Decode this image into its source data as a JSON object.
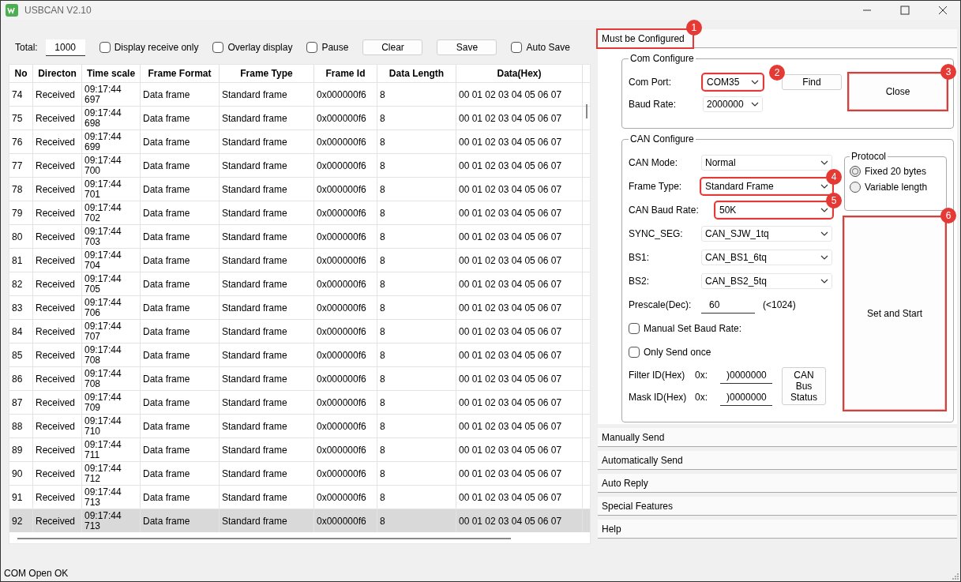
{
  "window": {
    "title": "USBCAN V2.10"
  },
  "toolbar": {
    "total_label": "Total:",
    "total_value": "1000",
    "options": [
      {
        "label": "Display receive only",
        "checked": false
      },
      {
        "label": "Overlay display",
        "checked": false
      },
      {
        "label": "Pause",
        "checked": false
      }
    ],
    "buttons": [
      "Clear",
      "Save"
    ],
    "auto_save": {
      "label": "Auto Save",
      "checked": false
    }
  },
  "table": {
    "columns": [
      "No",
      "Directon",
      "Time scale",
      "Frame Format",
      "Frame Type",
      "Frame Id",
      "Data Length",
      "Data(Hex)"
    ],
    "rows": [
      {
        "cells": [
          "74",
          "Received",
          "09:17:44\n697",
          "Data frame",
          "Standard frame",
          "0x000000f6",
          "8",
          "00 01 02 03 04 05 06 07"
        ],
        "selected": false
      },
      {
        "cells": [
          "75",
          "Received",
          "09:17:44\n698",
          "Data frame",
          "Standard frame",
          "0x000000f6",
          "8",
          "00 01 02 03 04 05 06 07"
        ],
        "selected": false
      },
      {
        "cells": [
          "76",
          "Received",
          "09:17:44\n699",
          "Data frame",
          "Standard frame",
          "0x000000f6",
          "8",
          "00 01 02 03 04 05 06 07"
        ],
        "selected": false
      },
      {
        "cells": [
          "77",
          "Received",
          "09:17:44\n700",
          "Data frame",
          "Standard frame",
          "0x000000f6",
          "8",
          "00 01 02 03 04 05 06 07"
        ],
        "selected": false
      },
      {
        "cells": [
          "78",
          "Received",
          "09:17:44\n701",
          "Data frame",
          "Standard frame",
          "0x000000f6",
          "8",
          "00 01 02 03 04 05 06 07"
        ],
        "selected": false
      },
      {
        "cells": [
          "79",
          "Received",
          "09:17:44\n702",
          "Data frame",
          "Standard frame",
          "0x000000f6",
          "8",
          "00 01 02 03 04 05 06 07"
        ],
        "selected": false
      },
      {
        "cells": [
          "80",
          "Received",
          "09:17:44\n703",
          "Data frame",
          "Standard frame",
          "0x000000f6",
          "8",
          "00 01 02 03 04 05 06 07"
        ],
        "selected": false
      },
      {
        "cells": [
          "81",
          "Received",
          "09:17:44\n704",
          "Data frame",
          "Standard frame",
          "0x000000f6",
          "8",
          "00 01 02 03 04 05 06 07"
        ],
        "selected": false
      },
      {
        "cells": [
          "82",
          "Received",
          "09:17:44\n705",
          "Data frame",
          "Standard frame",
          "0x000000f6",
          "8",
          "00 01 02 03 04 05 06 07"
        ],
        "selected": false
      },
      {
        "cells": [
          "83",
          "Received",
          "09:17:44\n706",
          "Data frame",
          "Standard frame",
          "0x000000f6",
          "8",
          "00 01 02 03 04 05 06 07"
        ],
        "selected": false
      },
      {
        "cells": [
          "84",
          "Received",
          "09:17:44\n707",
          "Data frame",
          "Standard frame",
          "0x000000f6",
          "8",
          "00 01 02 03 04 05 06 07"
        ],
        "selected": false
      },
      {
        "cells": [
          "85",
          "Received",
          "09:17:44\n708",
          "Data frame",
          "Standard frame",
          "0x000000f6",
          "8",
          "00 01 02 03 04 05 06 07"
        ],
        "selected": false
      },
      {
        "cells": [
          "86",
          "Received",
          "09:17:44\n708",
          "Data frame",
          "Standard frame",
          "0x000000f6",
          "8",
          "00 01 02 03 04 05 06 07"
        ],
        "selected": false
      },
      {
        "cells": [
          "87",
          "Received",
          "09:17:44\n709",
          "Data frame",
          "Standard frame",
          "0x000000f6",
          "8",
          "00 01 02 03 04 05 06 07"
        ],
        "selected": false
      },
      {
        "cells": [
          "88",
          "Received",
          "09:17:44\n710",
          "Data frame",
          "Standard frame",
          "0x000000f6",
          "8",
          "00 01 02 03 04 05 06 07"
        ],
        "selected": false
      },
      {
        "cells": [
          "89",
          "Received",
          "09:17:44\n711",
          "Data frame",
          "Standard frame",
          "0x000000f6",
          "8",
          "00 01 02 03 04 05 06 07"
        ],
        "selected": false
      },
      {
        "cells": [
          "90",
          "Received",
          "09:17:44\n712",
          "Data frame",
          "Standard frame",
          "0x000000f6",
          "8",
          "00 01 02 03 04 05 06 07"
        ],
        "selected": false
      },
      {
        "cells": [
          "91",
          "Received",
          "09:17:44\n713",
          "Data frame",
          "Standard frame",
          "0x000000f6",
          "8",
          "00 01 02 03 04 05 06 07"
        ],
        "selected": false
      },
      {
        "cells": [
          "92",
          "Received",
          "09:17:44\n713",
          "Data frame",
          "Standard frame",
          "0x000000f6",
          "8",
          "00 01 02 03 04 05 06 07"
        ],
        "selected": true
      }
    ]
  },
  "config": {
    "header": {
      "label": "Must be Configured",
      "callout": "1"
    },
    "com_configure": {
      "title": "Com Configure",
      "com_port_label": "Com Port:",
      "com_port": {
        "value": "COM35",
        "callout": "2"
      },
      "find_button": "Find",
      "baud_rate_label": "Baud Rate:",
      "baud_rate": "2000000",
      "close_button": {
        "label": "Close",
        "callout": "3"
      }
    },
    "can_configure": {
      "title": "CAN Configure",
      "fields": [
        {
          "label": "CAN Mode:",
          "value": "Normal"
        },
        {
          "label": "Frame Type:",
          "value": "Standard Frame",
          "callout": "4"
        },
        {
          "label": "CAN Baud Rate:",
          "value": "50K",
          "callout": "5"
        },
        {
          "label": "SYNC_SEG:",
          "value": "CAN_SJW_1tq"
        },
        {
          "label": "BS1:",
          "value": "CAN_BS1_6tq"
        },
        {
          "label": "BS2:",
          "value": "CAN_BS2_5tq"
        }
      ],
      "prescale_label": "Prescale(Dec):",
      "prescale_value": "60",
      "prescale_hint": "(<1024)",
      "checkboxes": [
        {
          "label": "Manual Set Baud Rate:",
          "checked": false
        },
        {
          "label": "Only Send once",
          "checked": false
        }
      ],
      "filter_label": "Filter ID(Hex)",
      "filter_prefix": "0x:",
      "filter_value": ")0000000",
      "mask_label": "Mask ID(Hex)",
      "mask_prefix": "0x:",
      "mask_value": ")0000000",
      "bus_status_button": "CAN\nBus\nStatus",
      "protocol": {
        "title": "Protocol",
        "options": [
          {
            "label": "Fixed 20 bytes",
            "selected": true
          },
          {
            "label": "Variable length",
            "selected": false
          }
        ]
      },
      "start_button": {
        "label": "Set and Start",
        "callout": "6"
      }
    }
  },
  "sections": [
    "Manually Send",
    "Automatically Send",
    "Auto Reply",
    "Special Features",
    "Help"
  ],
  "status_bar": "COM Open OK"
}
